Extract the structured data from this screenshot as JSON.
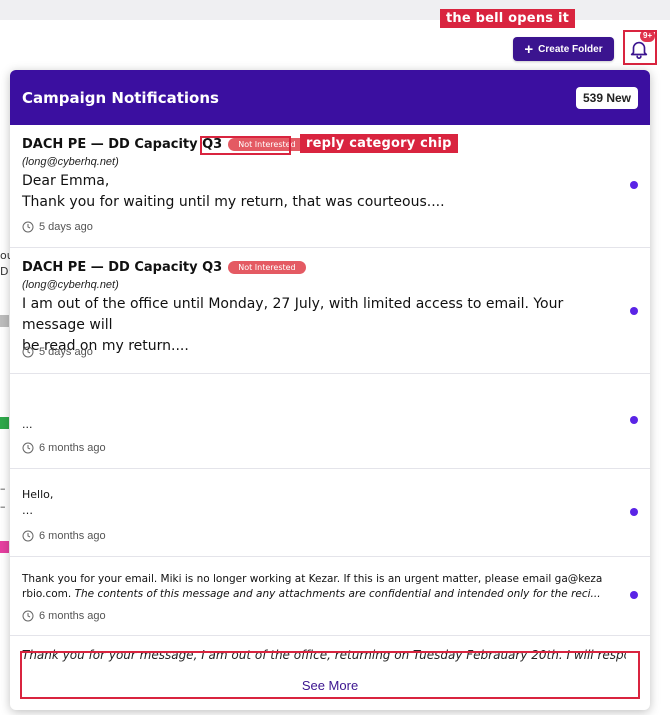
{
  "annotations": {
    "bell": "the bell opens it",
    "chip": "reply category chip"
  },
  "toolbar": {
    "create_folder_label": "Create Folder",
    "bell_badge": "9+"
  },
  "background_fragments": [
    "ou",
    "D",
    "–",
    "–",
    "on"
  ],
  "notifications": {
    "title": "Campaign Notifications",
    "count_label": "539 New",
    "see_more_label": "See More",
    "items": [
      {
        "title": "DACH PE — DD Capacity Q3",
        "chip": "Not Interested",
        "email": "(long@cyberhq.net)",
        "body_line1": "Dear Emma,",
        "body_line2": "Thank you for waiting until my return, that was courteous....",
        "time": "5 days ago",
        "unread": true
      },
      {
        "title": "DACH PE — DD Capacity Q3",
        "chip": "Not Interested",
        "email": "(long@cyberhq.net)",
        "body_line1": "I am out of the office until Monday, 27 July, with limited access to email. Your message will",
        "body_line2": "be read on my return....",
        "time": "5 days ago",
        "unread": true
      },
      {
        "body_line1": "...",
        "time": "6 months ago",
        "unread": true
      },
      {
        "body_line1": "Hello,",
        "body_line2": "…",
        "time": "6 months ago",
        "unread": true
      },
      {
        "body_line1": "Thank you for your email. Miki is no longer working at Kezar. If this is an urgent matter, please email ga@keza",
        "body_line2_plain": "rbio.com.",
        "body_line2_italic": " The contents of this message and any attachments are confidential and intended only for the reci...",
        "time": "6 months ago",
        "unread": true
      },
      {
        "body_line1": "Thank you for your message, I am out of the office, returning on Tuesday Febrauary 20th.   I will respo"
      }
    ]
  },
  "colors": {
    "header_purple": "#3b0fa0",
    "chip_red": "#e45a63",
    "unread_dot": "#5a24e6",
    "annotation_red": "#d9243f"
  }
}
